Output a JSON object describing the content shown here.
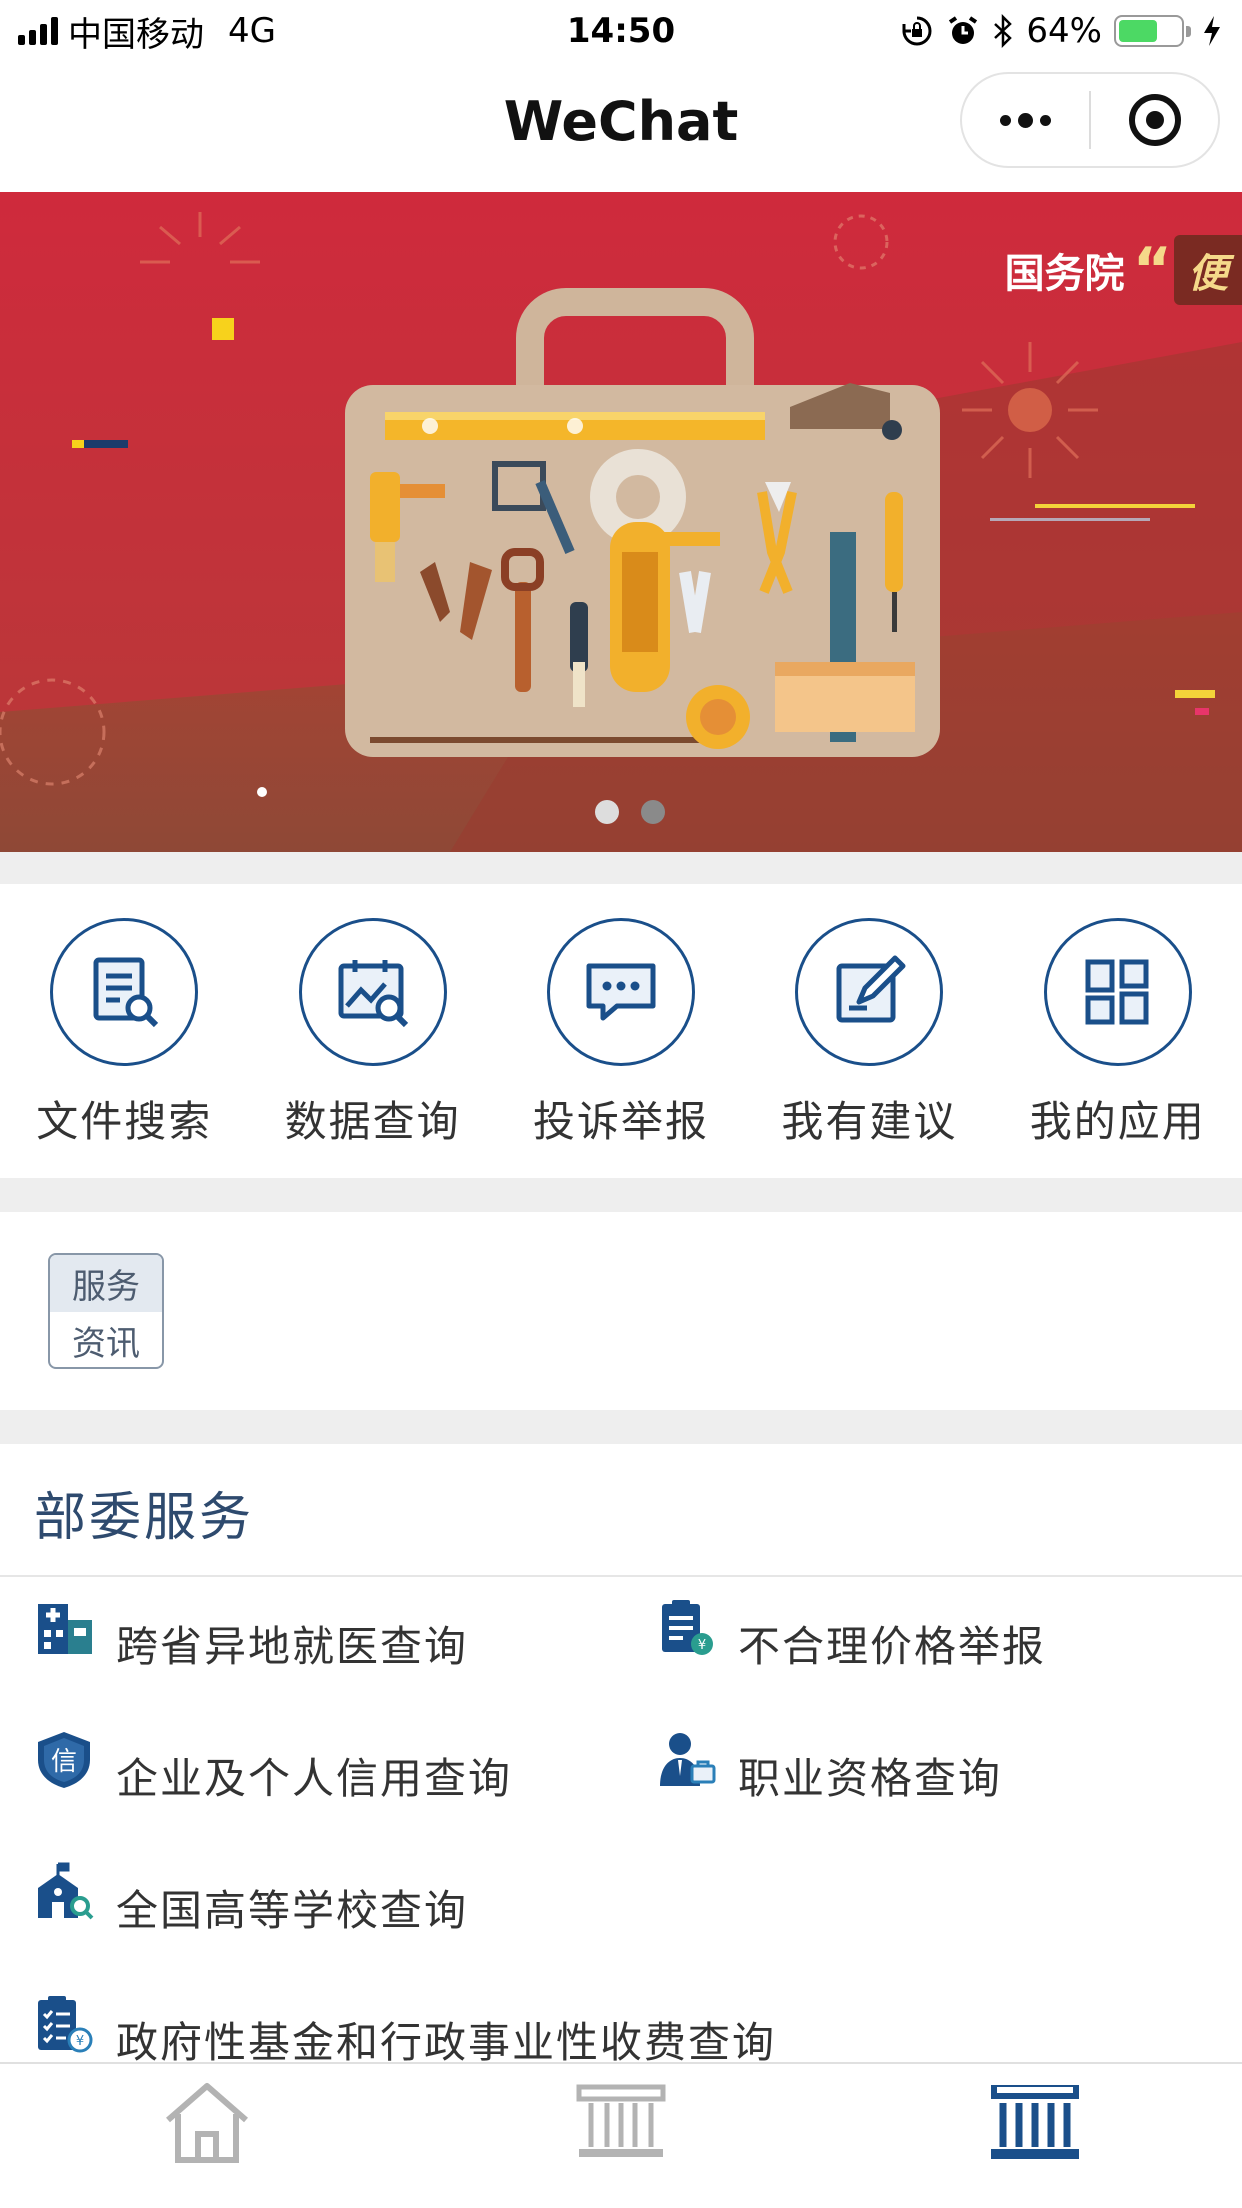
{
  "status_bar": {
    "carrier": "中国移动",
    "network": "4G",
    "time": "14:50",
    "battery": "64%",
    "battery_level": 0.64,
    "icons": [
      "orientation-lock-icon",
      "alarm-icon",
      "bluetooth-icon",
      "charging-icon"
    ]
  },
  "nav": {
    "title": "WeChat",
    "more_icon": "more-dots-icon",
    "close_icon": "target-close-icon"
  },
  "banner": {
    "tag_text": "国务院",
    "tag_quote": "“",
    "tag_highlight": "便",
    "active_page": 0,
    "page_count": 2,
    "colors": {
      "active_dot": "#dddddd",
      "inactive_dot": "#8a8a8a"
    }
  },
  "quick_actions": [
    {
      "label": "文件搜索",
      "icon": "document-search-icon"
    },
    {
      "label": "数据查询",
      "icon": "chart-search-icon"
    },
    {
      "label": "投诉举报",
      "icon": "chat-bubble-icon"
    },
    {
      "label": "我有建议",
      "icon": "edit-note-icon"
    },
    {
      "label": "我的应用",
      "icon": "apps-grid-icon"
    }
  ],
  "news": {
    "line1": "服务",
    "line2": "资讯"
  },
  "ministry": {
    "title": "部委服务",
    "items": [
      {
        "label": "跨省异地就医查询",
        "icon": "hospital-building-icon"
      },
      {
        "label": "不合理价格举报",
        "icon": "clipboard-price-icon"
      },
      {
        "label": "企业及个人信用查询",
        "icon": "credit-shield-icon"
      },
      {
        "label": "职业资格查询",
        "icon": "professional-person-icon"
      },
      {
        "label": "全国高等学校查询",
        "icon": "school-search-icon"
      },
      {
        "label": "政府性基金和行政事业性收费查询",
        "icon": "fee-checklist-icon"
      }
    ]
  },
  "tabbar": {
    "tabs": [
      {
        "name": "home",
        "icon": "home-icon",
        "active": false
      },
      {
        "name": "government-building",
        "icon": "building-icon",
        "active": false
      },
      {
        "name": "ministry-building",
        "icon": "pillar-building-icon",
        "active": true
      }
    ]
  },
  "colors": {
    "accent": "#1a4f8a",
    "section_title": "#2e4a6e",
    "banner_red": "#cc2a3a",
    "tab_inactive": "#b3b3b3",
    "tab_active": "#1a4f8a"
  }
}
